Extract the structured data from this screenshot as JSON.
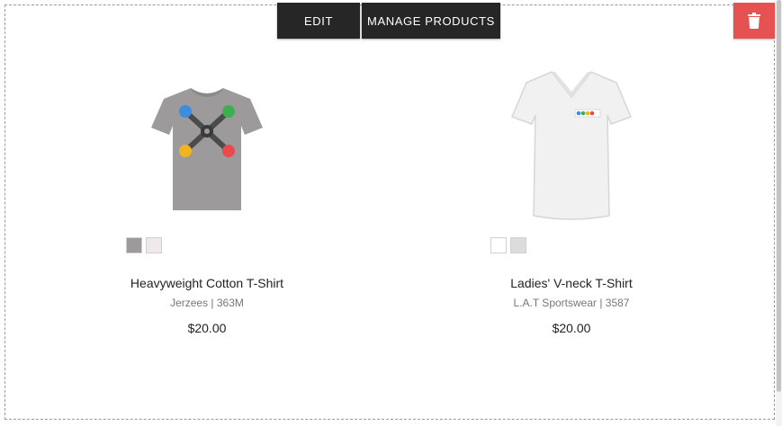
{
  "toolbar": {
    "edit_label": "EDIT",
    "manage_label": "MANAGE PRODUCTS"
  },
  "colors": {
    "toolbar_bg": "#262626",
    "delete_bg": "#e65252"
  },
  "products": [
    {
      "name": "Heavyweight Cotton T-Shirt",
      "brand_sku": "Jerzees | 363M",
      "price": "$20.00",
      "swatches": [
        "#9d9a9c",
        "#efe9ea"
      ]
    },
    {
      "name": "Ladies' V-neck T-Shirt",
      "brand_sku": "L.A.T Sportswear | 3587",
      "price": "$20.00",
      "swatches": [
        "#ffffff",
        "#dcdcdc"
      ]
    }
  ]
}
